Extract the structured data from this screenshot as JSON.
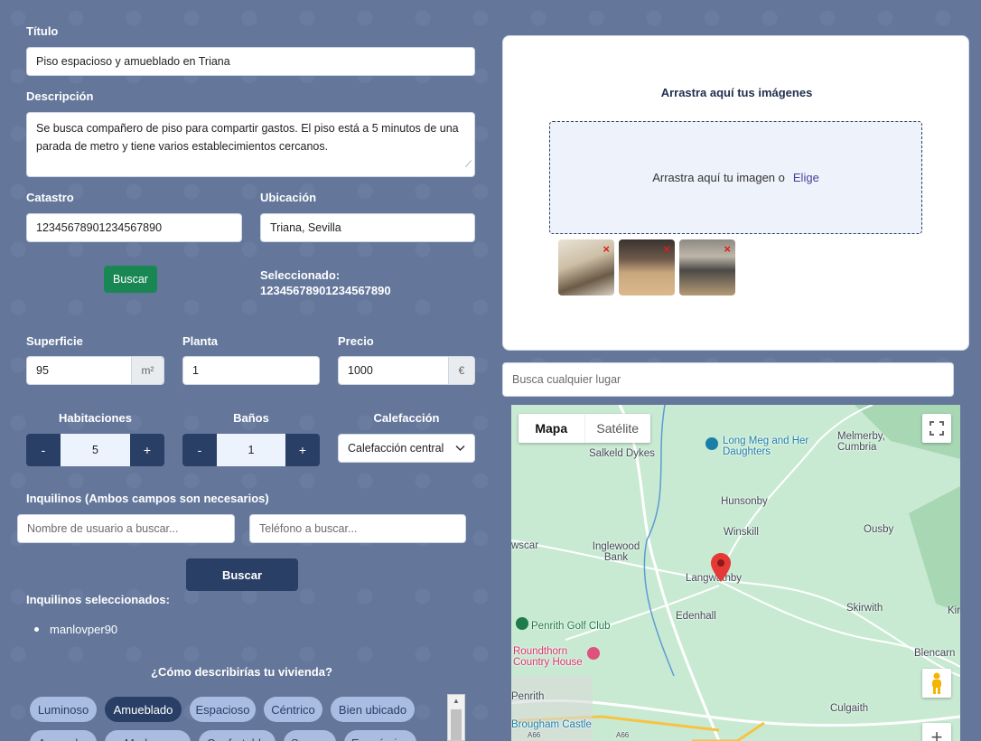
{
  "form": {
    "titulo_label": "Título",
    "titulo_value": "Piso espacioso y amueblado en Triana",
    "descripcion_label": "Descripción",
    "descripcion_value": "Se busca compañero de piso para compartir gastos. El piso está a 5 minutos de una parada de metro y tiene varios establecimientos cercanos.",
    "catastro_label": "Catastro",
    "catastro_value": "12345678901234567890",
    "ubicacion_label": "Ubicación",
    "ubicacion_value": "Triana, Sevilla",
    "buscar_label": "Buscar",
    "seleccionado_label": "Seleccionado:",
    "seleccionado_value": "12345678901234567890",
    "superficie_label": "Superficie",
    "superficie_value": "95",
    "superficie_unit": "m²",
    "planta_label": "Planta",
    "planta_value": "1",
    "precio_label": "Precio",
    "precio_value": "1000",
    "precio_unit": "€",
    "habitaciones_label": "Habitaciones",
    "habitaciones_value": "5",
    "banos_label": "Baños",
    "banos_value": "1",
    "calefaccion_label": "Calefacción",
    "calefaccion_value": "Calefacción central",
    "minus": "-",
    "plus": "+"
  },
  "inquilinos": {
    "title": "Inquilinos (Ambos campos son necesarios)",
    "user_placeholder": "Nombre de usuario a buscar...",
    "phone_placeholder": "Teléfono a buscar...",
    "buscar_label": "Buscar",
    "selected_title": "Inquilinos seleccionados:",
    "selected": [
      "manlovper90"
    ]
  },
  "describe": {
    "question": "¿Cómo describirías tu vivienda?",
    "chips": [
      "Luminoso",
      "Amueblado",
      "Espacioso",
      "Céntrico",
      "Bien ubicado"
    ],
    "active": "Amueblado",
    "second_row": [
      "Acogedor",
      "Moderno",
      "Confortable",
      "Seguro",
      "Económico"
    ]
  },
  "images": {
    "title": "Arrastra aquí tus imágenes",
    "drop_text": "Arrastra aquí tu imagen o",
    "choose_link": "Elige",
    "remove": "×"
  },
  "map": {
    "search_placeholder": "Busca cualquier lugar",
    "tab_map": "Mapa",
    "tab_satellite": "Satélite",
    "places": [
      "Salkeld Dykes",
      "Long Meg and Her Daughters",
      "Melmerby, Cumbria",
      "Hunsonby",
      "Winskill",
      "Ousby",
      "Inglewood Bank",
      "Langwathby",
      "Skirwith",
      "Edenhall",
      "Penrith Golf Club",
      "Roundthorn Country House",
      "Blencarn",
      "Penrith",
      "Culgaith",
      "Brougham Castle",
      "wscar",
      "Kir",
      "A66",
      "A66"
    ],
    "zoom_in": "+"
  },
  "colors": {
    "background": "#64779b",
    "navy": "#2a3f66",
    "green": "#198754",
    "chip": "#a9bde3",
    "pin": "#e53935"
  }
}
